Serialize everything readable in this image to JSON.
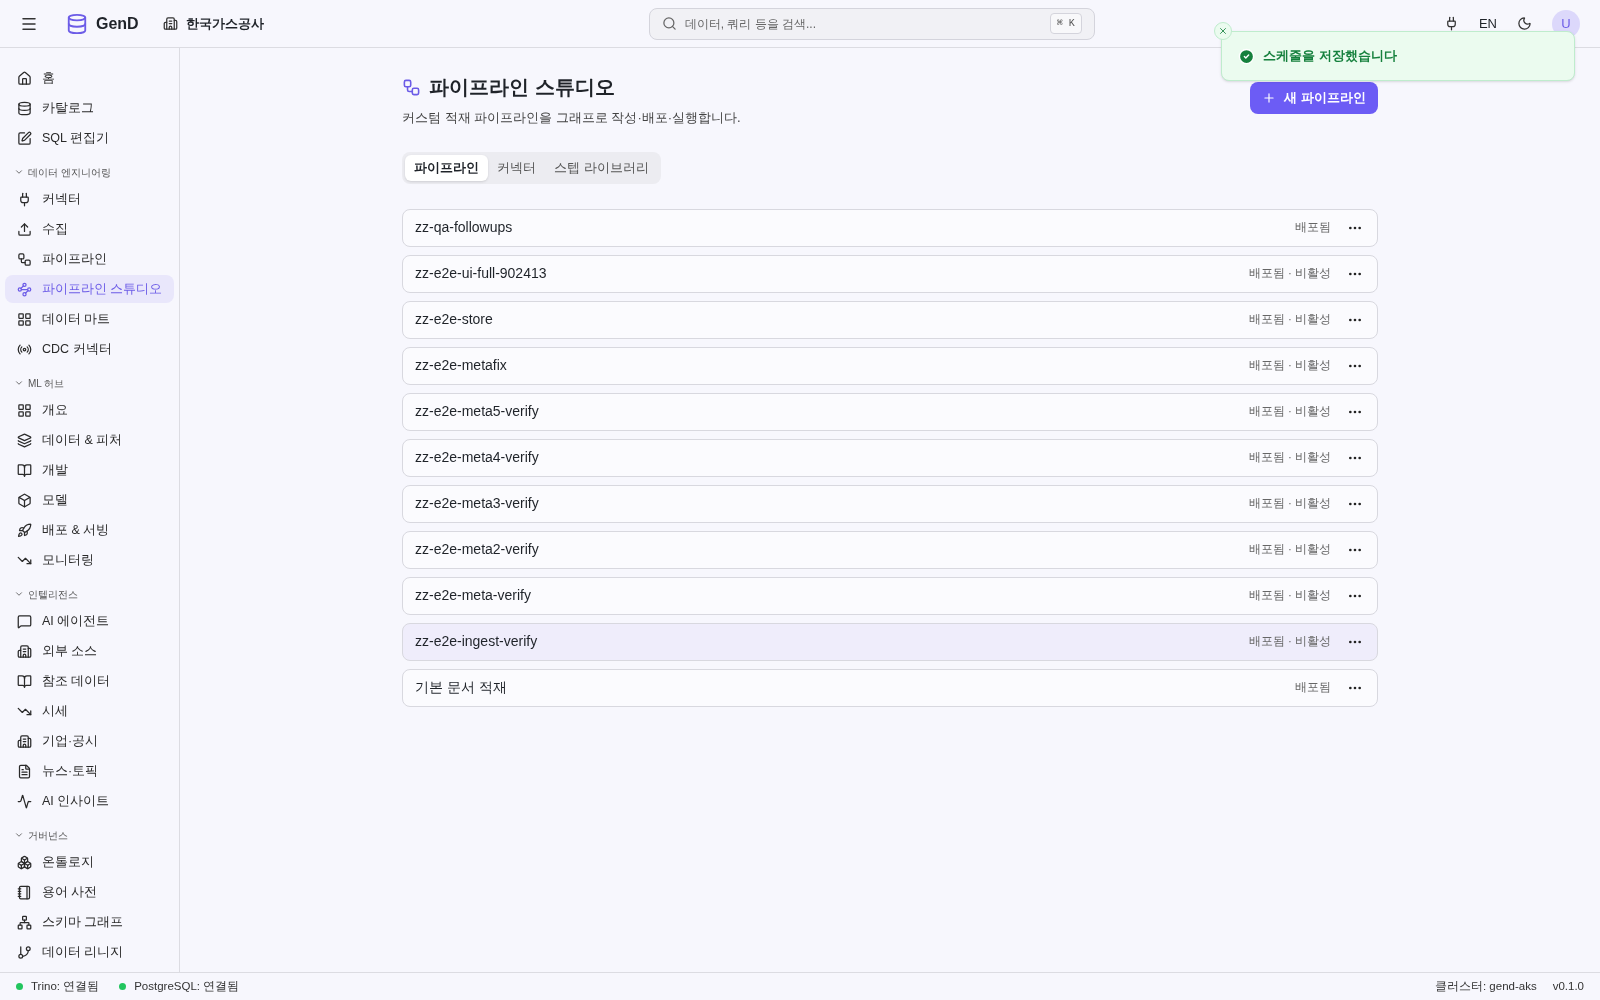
{
  "header": {
    "logo": "GenD",
    "org": "한국가스공사",
    "search": {
      "placeholder": "데이터, 쿼리 등을 검색...",
      "shortcut": "⌘ K"
    },
    "language": "EN",
    "avatar": "U"
  },
  "sidebar": {
    "sections": [
      {
        "items": [
          {
            "label": "홈",
            "selected": false
          },
          {
            "label": "카탈로그",
            "selected": false
          },
          {
            "label": "SQL 편집기",
            "selected": false
          }
        ]
      },
      {
        "title": "데이터 엔지니어링",
        "expanded": true,
        "items": [
          {
            "label": "커넥터",
            "selected": false
          },
          {
            "label": "수집",
            "selected": false
          },
          {
            "label": "파이프라인",
            "selected": false
          },
          {
            "label": "파이프라인 스튜디오",
            "selected": true
          },
          {
            "label": "데이터 마트",
            "selected": false
          },
          {
            "label": "CDC 커넥터",
            "selected": false
          }
        ]
      },
      {
        "title": "ML 허브",
        "expanded": true,
        "items": [
          {
            "label": "개요",
            "selected": false
          },
          {
            "label": "데이터 & 피처",
            "selected": false
          },
          {
            "label": "개발",
            "selected": false
          },
          {
            "label": "모델",
            "selected": false
          },
          {
            "label": "배포 & 서빙",
            "selected": false
          },
          {
            "label": "모니터링",
            "selected": false
          }
        ]
      },
      {
        "title": "인텔리전스",
        "expanded": true,
        "items": [
          {
            "label": "AI 에이전트",
            "selected": false
          },
          {
            "label": "외부 소스",
            "selected": false
          },
          {
            "label": "참조 데이터",
            "selected": false
          },
          {
            "label": "시세",
            "selected": false
          },
          {
            "label": "기업·공시",
            "selected": false
          },
          {
            "label": "뉴스·토픽",
            "selected": false
          },
          {
            "label": "AI 인사이트",
            "selected": false
          }
        ]
      },
      {
        "title": "거버넌스",
        "expanded": true,
        "items": [
          {
            "label": "온톨로지",
            "selected": false
          },
          {
            "label": "용어 사전",
            "selected": false
          },
          {
            "label": "스키마 그래프",
            "selected": false
          },
          {
            "label": "데이터 리니지",
            "selected": false
          }
        ]
      }
    ]
  },
  "page": {
    "title": "파이프라인 스튜디오",
    "subtitle": "커스텀 적재 파이프라인을 그래프로 작성·배포·실행합니다.",
    "new_button": "새 파이프라인",
    "tabs": [
      {
        "label": "파이프라인",
        "selected": true
      },
      {
        "label": "커넥터",
        "selected": false
      },
      {
        "label": "스텝 라이브러리",
        "selected": false
      }
    ],
    "pipelines": [
      {
        "name": "zz-qa-followups",
        "status": "배포됨",
        "selected": false
      },
      {
        "name": "zz-e2e-ui-full-902413",
        "status": "배포됨 · 비활성",
        "selected": false
      },
      {
        "name": "zz-e2e-store",
        "status": "배포됨 · 비활성",
        "selected": false
      },
      {
        "name": "zz-e2e-metafix",
        "status": "배포됨 · 비활성",
        "selected": false
      },
      {
        "name": "zz-e2e-meta5-verify",
        "status": "배포됨 · 비활성",
        "selected": false
      },
      {
        "name": "zz-e2e-meta4-verify",
        "status": "배포됨 · 비활성",
        "selected": false
      },
      {
        "name": "zz-e2e-meta3-verify",
        "status": "배포됨 · 비활성",
        "selected": false
      },
      {
        "name": "zz-e2e-meta2-verify",
        "status": "배포됨 · 비활성",
        "selected": false
      },
      {
        "name": "zz-e2e-meta-verify",
        "status": "배포됨 · 비활성",
        "selected": false
      },
      {
        "name": "zz-e2e-ingest-verify",
        "status": "배포됨 · 비활성",
        "selected": true
      },
      {
        "name": "기본 문서 적재",
        "status": "배포됨",
        "selected": false
      }
    ]
  },
  "toast": {
    "message": "스케줄을 저장했습니다"
  },
  "status_bar": {
    "connections": [
      {
        "label": "Trino: 연결됨",
        "connected": true
      },
      {
        "label": "PostgreSQL: 연결됨",
        "connected": true
      }
    ],
    "cluster": "클러스터: gend-aks",
    "version": "v0.1.0"
  }
}
